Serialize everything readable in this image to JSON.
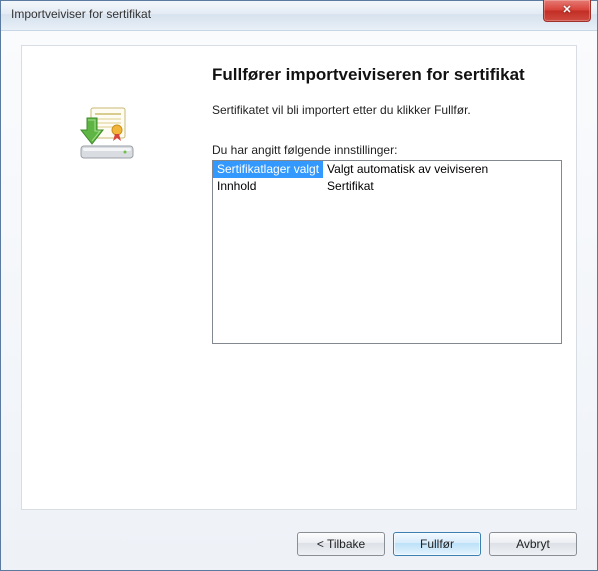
{
  "window": {
    "title": "Importveiviser for sertifikat"
  },
  "main": {
    "title": "Fullfører importveiviseren for sertifikat",
    "description": "Sertifikatet vil bli importert etter du klikker Fullfør.",
    "settings_label": "Du har angitt følgende innstillinger:",
    "settings_rows": [
      {
        "key": "Sertifikatlager valgt",
        "value": "Valgt automatisk av veiviseren"
      },
      {
        "key": "Innhold",
        "value": "Sertifikat"
      }
    ]
  },
  "buttons": {
    "back": "< Tilbake",
    "finish": "Fullfør",
    "cancel": "Avbryt"
  }
}
